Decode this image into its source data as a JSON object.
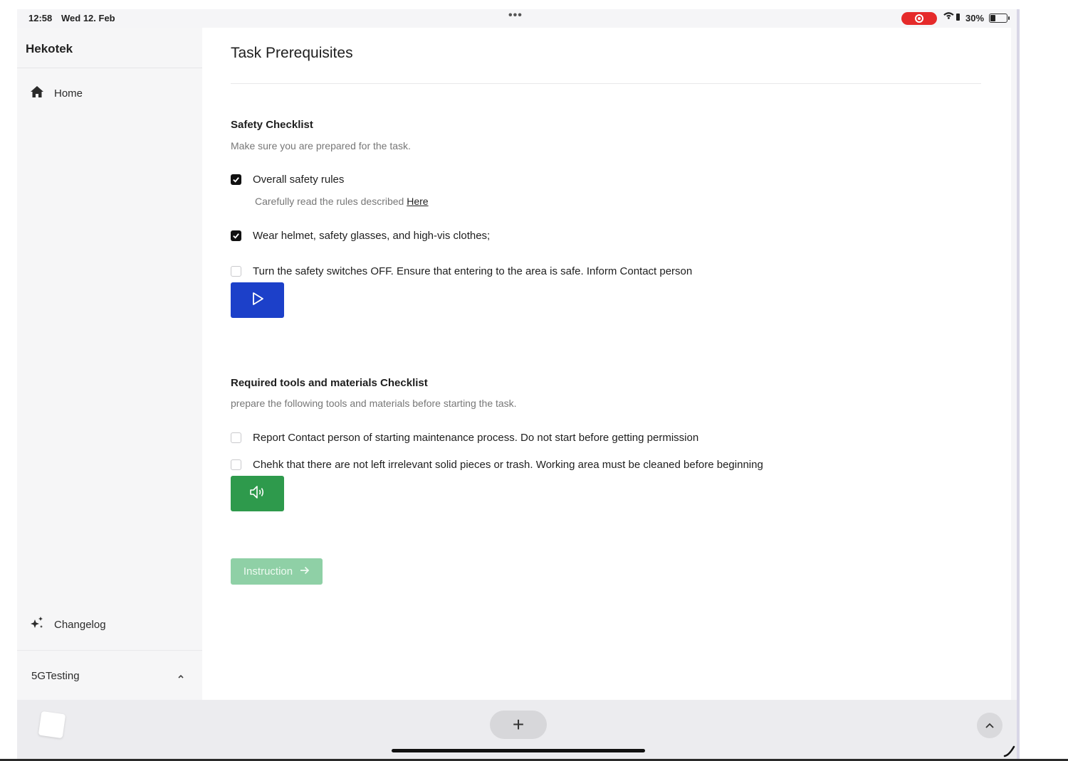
{
  "status_bar": {
    "time": "12:58",
    "date": "Wed 12. Feb",
    "battery": "30%"
  },
  "sidebar": {
    "brand": "Hekotek",
    "nav": [
      {
        "label": "Home",
        "icon": "home-icon"
      }
    ],
    "footer_nav": {
      "label": "Changelog",
      "icon": "sparkles-icon"
    },
    "workspace": "5GTesting"
  },
  "main": {
    "title": "Task Prerequisites",
    "safety": {
      "title": "Safety Checklist",
      "subtitle": "Make sure you are prepared for the task.",
      "items": [
        {
          "label": "Overall safety rules",
          "checked": true,
          "hint": "Carefully read the rules described",
          "hint_link": "Here"
        },
        {
          "label": "Wear helmet, safety glasses, and high-vis clothes;",
          "checked": true
        },
        {
          "label": "Turn the safety switches OFF. Ensure that entering to the area is safe. Inform Contact person",
          "checked": false
        }
      ],
      "action_icon": "play-icon"
    },
    "tools": {
      "title": "Required tools and materials Checklist",
      "subtitle": "prepare the following tools and materials before starting the task.",
      "items": [
        {
          "label": "Report Contact person of starting maintenance process. Do not start before getting permission",
          "checked": false
        },
        {
          "label": "Chehk that there are not left irrelevant solid pieces or trash. Working area must be cleaned before beginning",
          "checked": false
        }
      ],
      "action_icon": "speaker-icon"
    },
    "next_button": "Instruction"
  },
  "dock": {
    "add_label": "+"
  },
  "colors": {
    "primary_blue": "#1c40c9",
    "success_green": "#2e9a4c",
    "disabled_green": "#8fd0a6",
    "record_red": "#e52a2a"
  }
}
